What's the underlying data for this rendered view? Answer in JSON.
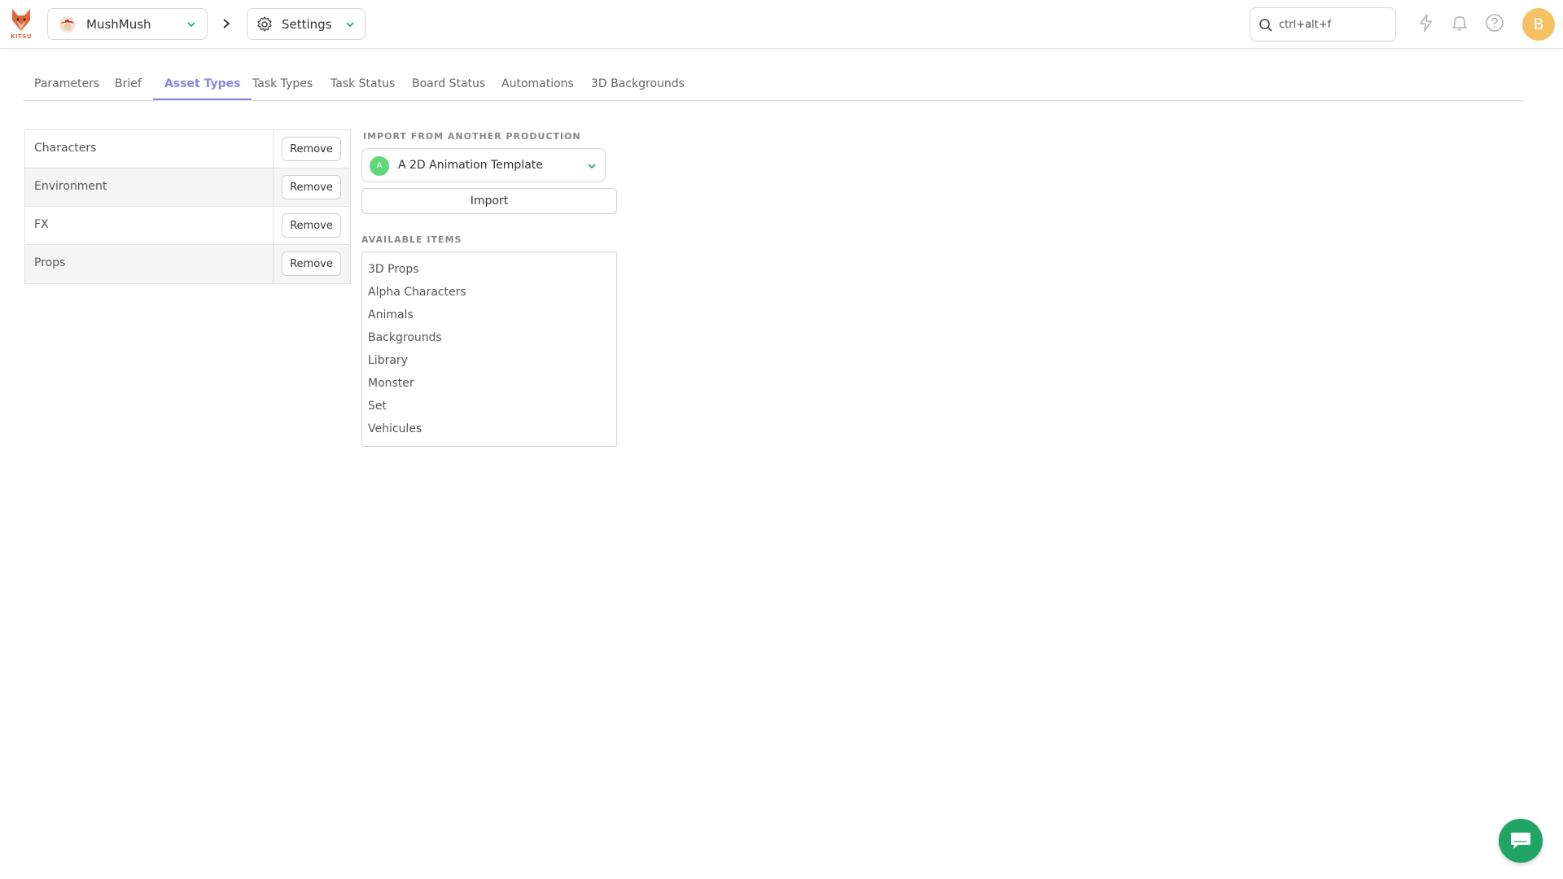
{
  "app": {
    "logo_text": "KITSU"
  },
  "header": {
    "production": {
      "label": "MushMush"
    },
    "section": {
      "label": "Settings"
    },
    "search": {
      "placeholder": "ctrl+alt+f"
    },
    "user": {
      "initial": "B"
    }
  },
  "tabs": [
    {
      "label": "Parameters"
    },
    {
      "label": "Brief"
    },
    {
      "label": "Asset Types",
      "active": true
    },
    {
      "label": "Task Types"
    },
    {
      "label": "Task Status"
    },
    {
      "label": "Board Status"
    },
    {
      "label": "Automations"
    },
    {
      "label": "3D Backgrounds"
    }
  ],
  "asset_types": [
    {
      "name": "Characters",
      "action": "Remove"
    },
    {
      "name": "Environment",
      "action": "Remove"
    },
    {
      "name": "FX",
      "action": "Remove"
    },
    {
      "name": "Props",
      "action": "Remove"
    }
  ],
  "import_panel": {
    "title": "IMPORT FROM ANOTHER PRODUCTION",
    "selected_production": {
      "initial": "A",
      "label": "A 2D Animation Template"
    },
    "import_label": "Import",
    "available_title": "AVAILABLE ITEMS",
    "available_items": [
      "3D Props",
      "Alpha Characters",
      "Animals",
      "Backgrounds",
      "Library",
      "Monster",
      "Set",
      "Vehicules"
    ]
  },
  "colors": {
    "accent": "#8b85e8",
    "user_avatar": "#f4c163",
    "production_dot": "#5ed879",
    "chat": "#1fa463"
  }
}
